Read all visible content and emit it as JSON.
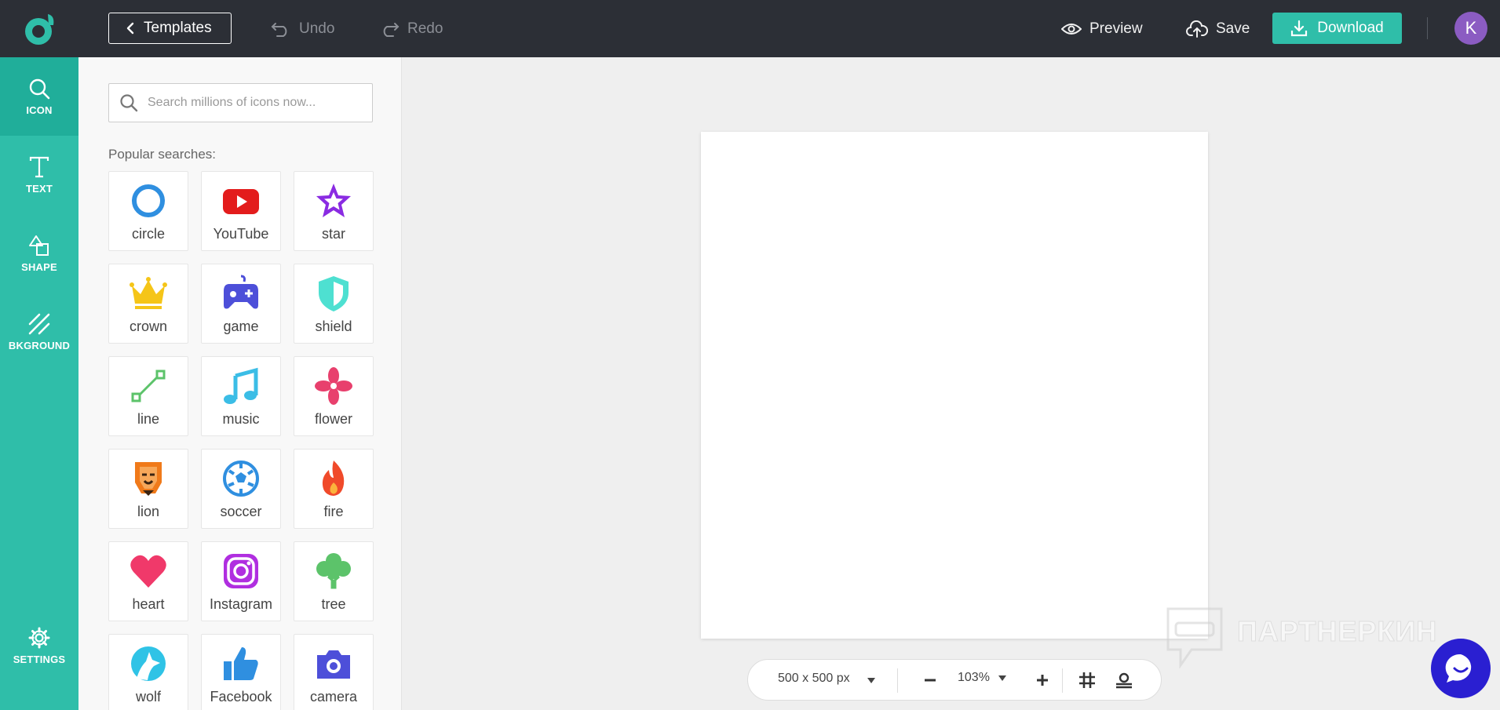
{
  "topbar": {
    "templates_label": "Templates",
    "undo_label": "Undo",
    "redo_label": "Redo",
    "preview_label": "Preview",
    "save_label": "Save",
    "download_label": "Download",
    "avatar_initial": "K"
  },
  "rail": {
    "items": [
      {
        "label": "ICON",
        "icon": "search-icon"
      },
      {
        "label": "TEXT",
        "icon": "text-icon"
      },
      {
        "label": "SHAPE",
        "icon": "shape-icon"
      },
      {
        "label": "BKGROUND",
        "icon": "background-icon"
      },
      {
        "label": "SETTINGS",
        "icon": "gear-icon"
      }
    ]
  },
  "panel": {
    "search_placeholder": "Search millions of icons now...",
    "popular_label": "Popular searches:",
    "tiles": [
      {
        "label": "circle",
        "icon": "circle-icon",
        "color": "#2f8fe0"
      },
      {
        "label": "YouTube",
        "icon": "youtube-icon",
        "color": "#e31c1c"
      },
      {
        "label": "star",
        "icon": "star-icon",
        "color": "#8a2be2"
      },
      {
        "label": "crown",
        "icon": "crown-icon",
        "color": "#f5c518"
      },
      {
        "label": "game",
        "icon": "gamepad-icon",
        "color": "#4d4fd9"
      },
      {
        "label": "shield",
        "icon": "shield-icon",
        "color": "#4ee0d1"
      },
      {
        "label": "line",
        "icon": "line-icon",
        "color": "#5cc36a"
      },
      {
        "label": "music",
        "icon": "music-icon",
        "color": "#3bbde6"
      },
      {
        "label": "flower",
        "icon": "flower-icon",
        "color": "#e8406d"
      },
      {
        "label": "lion",
        "icon": "lion-icon",
        "color": "#f07a1a"
      },
      {
        "label": "soccer",
        "icon": "soccer-icon",
        "color": "#2f8fe0"
      },
      {
        "label": "fire",
        "icon": "fire-icon",
        "color": "#f04a2a"
      },
      {
        "label": "heart",
        "icon": "heart-icon",
        "color": "#f0396a"
      },
      {
        "label": "Instagram",
        "icon": "instagram-icon",
        "color": "#b02ee0"
      },
      {
        "label": "tree",
        "icon": "tree-icon",
        "color": "#5cc36a"
      },
      {
        "label": "wolf",
        "icon": "wolf-icon",
        "color": "#2fc3e6"
      },
      {
        "label": "Facebook",
        "icon": "thumbs-up-icon",
        "color": "#2f8fe0"
      },
      {
        "label": "camera",
        "icon": "camera-icon",
        "color": "#4d4fd9"
      }
    ]
  },
  "bottombar": {
    "size_label": "500 x 500 px",
    "zoom_label": "103%"
  },
  "watermark": {
    "text": "ПАРТНЕРКИН"
  },
  "colors": {
    "accent": "#2fbea9",
    "topbar": "#2c2f36",
    "avatar": "#8b5cc2",
    "chat": "#2a1fd1"
  }
}
